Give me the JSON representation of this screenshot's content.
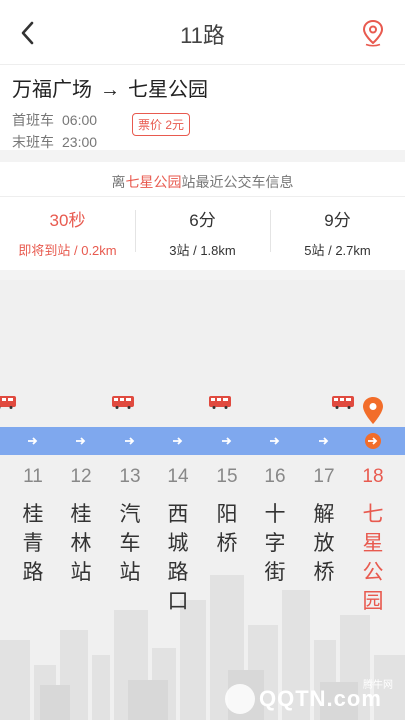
{
  "header": {
    "title": "11路"
  },
  "route": {
    "from": "万福广场",
    "arrow": "→",
    "to": "七星公园",
    "first_label": "首班车",
    "first_time": "06:00",
    "last_label": "末班车",
    "last_time": "23:00",
    "fare": "票价 2元"
  },
  "info": {
    "prefix": "离",
    "station": "七星公园",
    "suffix": "站最近公交车信息",
    "etas": [
      {
        "time": "30秒",
        "detail": "即将到站 / 0.2km"
      },
      {
        "time": "6分",
        "detail": "3站 / 1.8km"
      },
      {
        "time": "9分",
        "detail": "5站 / 2.7km"
      }
    ]
  },
  "stops": [
    {
      "num": "11",
      "name": [
        "桂",
        "青",
        "路"
      ]
    },
    {
      "num": "12",
      "name": [
        "桂",
        "林",
        "站"
      ]
    },
    {
      "num": "13",
      "name": [
        "汽",
        "车",
        "站"
      ]
    },
    {
      "num": "14",
      "name": [
        "西",
        "城",
        "路",
        "口"
      ]
    },
    {
      "num": "15",
      "name": [
        "阳",
        "桥"
      ]
    },
    {
      "num": "16",
      "name": [
        "十",
        "字",
        "街"
      ]
    },
    {
      "num": "17",
      "name": [
        "解",
        "放",
        "桥"
      ]
    },
    {
      "num": "18",
      "name": [
        "七",
        "星",
        "公",
        "园"
      ]
    }
  ],
  "watermark": {
    "text": "QQTN.com",
    "sub": "腾牛网"
  },
  "colors": {
    "accent": "#e85a4f",
    "track": "#7fa8ee",
    "destination": "#f26d2a"
  }
}
